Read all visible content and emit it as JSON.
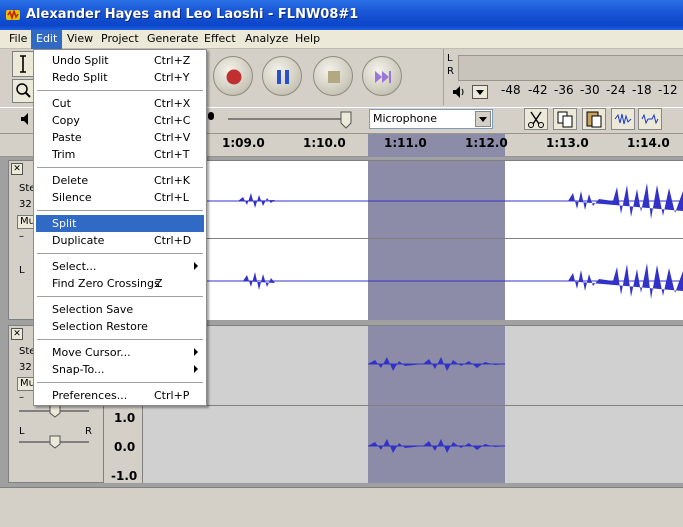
{
  "window": {
    "title": "Alexander Hayes and Leo Laoshi - FLNW08#1"
  },
  "menubar": [
    {
      "label": "File"
    },
    {
      "label": "Edit"
    },
    {
      "label": "View"
    },
    {
      "label": "Project"
    },
    {
      "label": "Generate"
    },
    {
      "label": "Effect"
    },
    {
      "label": "Analyze"
    },
    {
      "label": "Help"
    }
  ],
  "edit_menu": {
    "items": [
      {
        "label": "Undo Split",
        "shortcut": "Ctrl+Z"
      },
      {
        "label": "Redo Split",
        "shortcut": "Ctrl+Y"
      },
      {
        "label": "Cut",
        "shortcut": "Ctrl+X"
      },
      {
        "label": "Copy",
        "shortcut": "Ctrl+C"
      },
      {
        "label": "Paste",
        "shortcut": "Ctrl+V"
      },
      {
        "label": "Trim",
        "shortcut": "Ctrl+T"
      },
      {
        "label": "Delete",
        "shortcut": "Ctrl+K"
      },
      {
        "label": "Silence",
        "shortcut": "Ctrl+L"
      },
      {
        "label": "Split",
        "shortcut": ""
      },
      {
        "label": "Duplicate",
        "shortcut": "Ctrl+D"
      },
      {
        "label": "Select...",
        "shortcut": ""
      },
      {
        "label": "Find Zero Crossings",
        "shortcut": "Z"
      },
      {
        "label": "Selection Save",
        "shortcut": ""
      },
      {
        "label": "Selection Restore",
        "shortcut": ""
      },
      {
        "label": "Move Cursor...",
        "shortcut": ""
      },
      {
        "label": "Snap-To...",
        "shortcut": ""
      },
      {
        "label": "Preferences...",
        "shortcut": "Ctrl+P"
      }
    ],
    "highlighted": "Split"
  },
  "meter": {
    "channels": [
      "L",
      "R"
    ],
    "scale": [
      "-48",
      "-42",
      "-36",
      "-30",
      "-24",
      "-18",
      "-12"
    ]
  },
  "input_source": {
    "value": "Microphone"
  },
  "ruler": {
    "ticks": [
      "1:09.0",
      "1:10.0",
      "1:11.0",
      "1:12.0",
      "1:13.0",
      "1:14.0"
    ]
  },
  "tracks": [
    {
      "info_lines": [
        "Ste",
        "32"
      ],
      "mute": "Mu",
      "gain": "–",
      "pan_l": "L"
    },
    {
      "info_lines": [
        "Ste",
        "32"
      ],
      "mute": "Mu",
      "gain": "–",
      "pan_l": "L",
      "pan_r": "R"
    }
  ],
  "vruler": [
    "1.0",
    "0.0",
    "-1.0"
  ],
  "colors": {
    "selection": "#8c8ca8",
    "waveform": "#3232c8",
    "menu_highlight": "#316ac5",
    "titlebar": "#0b45c9"
  }
}
